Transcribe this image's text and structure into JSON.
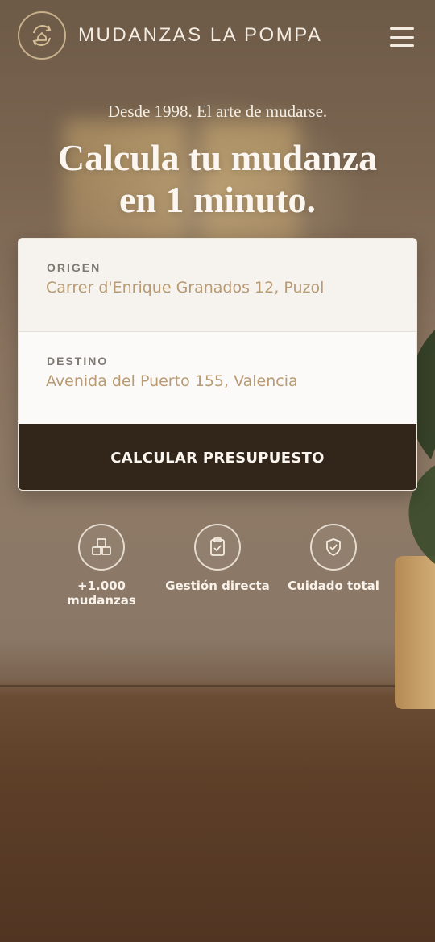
{
  "brand": {
    "name": "MUDANZAS LA POMPA",
    "logo_icon": "house-cycle-icon"
  },
  "menu": {
    "icon": "hamburger-menu-icon"
  },
  "hero": {
    "tagline": "Desde 1998. El arte de mudarse.",
    "headline_line1": "Calcula tu mudanza",
    "headline_line2": "en 1 minuto."
  },
  "form": {
    "origin": {
      "label": "ORIGEN",
      "value": "Carrer d'Enrique Granados 12, Puzol"
    },
    "destination": {
      "label": "DESTINO",
      "value": "Avenida del Puerto 155, Valencia"
    },
    "submit_label": "CALCULAR PRESUPUESTO"
  },
  "features": [
    {
      "label": "+1.000 mudanzas",
      "icon": "boxes-icon"
    },
    {
      "label": "Gestión directa",
      "icon": "clipboard-check-icon"
    },
    {
      "label": "Cuidado total",
      "icon": "shield-check-icon"
    }
  ],
  "colors": {
    "accent": "#b89a73",
    "button": "#32261b",
    "text_light": "#f5eee4"
  }
}
